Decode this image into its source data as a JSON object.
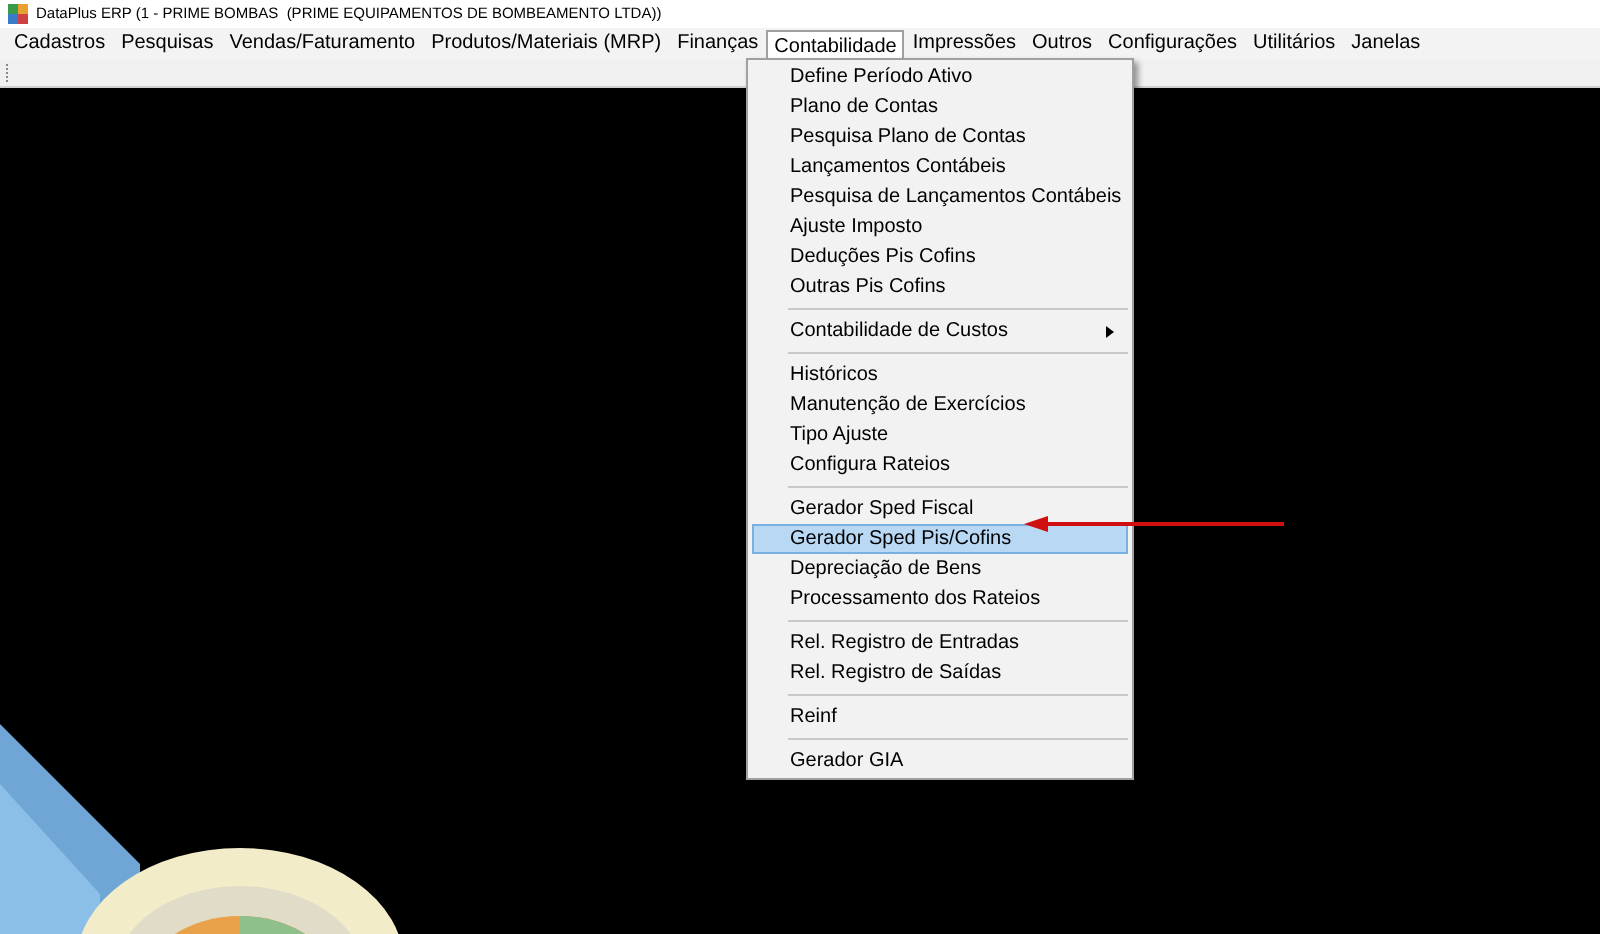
{
  "window": {
    "title": "DataPlus ERP (1 - PRIME BOMBAS  (PRIME EQUIPAMENTOS DE BOMBEAMENTO LTDA))"
  },
  "menubar": [
    {
      "label": "Cadastros",
      "selected": false
    },
    {
      "label": "Pesquisas",
      "selected": false
    },
    {
      "label": "Vendas/Faturamento",
      "selected": false
    },
    {
      "label": "Produtos/Materiais (MRP)",
      "selected": false
    },
    {
      "label": "Finanças",
      "selected": false
    },
    {
      "label": "Contabilidade",
      "selected": true
    },
    {
      "label": "Impressões",
      "selected": false
    },
    {
      "label": "Outros",
      "selected": false
    },
    {
      "label": "Configurações",
      "selected": false
    },
    {
      "label": "Utilitários",
      "selected": false
    },
    {
      "label": "Janelas",
      "selected": false
    }
  ],
  "dropdown": {
    "groups": [
      {
        "items": [
          {
            "label": "Define Período Ativo",
            "kind": "item",
            "selected": false
          },
          {
            "label": "Plano de Contas",
            "kind": "item",
            "selected": false
          },
          {
            "label": "Pesquisa Plano de Contas",
            "kind": "item",
            "selected": false
          },
          {
            "label": "Lançamentos Contábeis",
            "kind": "item",
            "selected": false
          },
          {
            "label": "Pesquisa de Lançamentos Contábeis",
            "kind": "item",
            "selected": false
          },
          {
            "label": "Ajuste Imposto",
            "kind": "item",
            "selected": false
          },
          {
            "label": "Deduções Pis Cofins",
            "kind": "item",
            "selected": false
          },
          {
            "label": "Outras Pis Cofins",
            "kind": "item",
            "selected": false
          }
        ]
      },
      {
        "items": [
          {
            "label": "Contabilidade de Custos",
            "kind": "submenu",
            "selected": false
          }
        ]
      },
      {
        "items": [
          {
            "label": "Históricos",
            "kind": "item",
            "selected": false
          },
          {
            "label": "Manutenção de Exercícios",
            "kind": "item",
            "selected": false
          },
          {
            "label": "Tipo Ajuste",
            "kind": "item",
            "selected": false
          },
          {
            "label": "Configura Rateios",
            "kind": "item",
            "selected": false
          }
        ]
      },
      {
        "items": [
          {
            "label": "Gerador Sped Fiscal",
            "kind": "item",
            "selected": false
          },
          {
            "label": "Gerador Sped Pis/Cofins",
            "kind": "item",
            "selected": true
          },
          {
            "label": "Depreciação de Bens",
            "kind": "item",
            "selected": false
          },
          {
            "label": "Processamento dos Rateios",
            "kind": "item",
            "selected": false
          }
        ]
      },
      {
        "items": [
          {
            "label": "Rel. Registro de Entradas",
            "kind": "item",
            "selected": false
          },
          {
            "label": "Rel. Registro de Saídas",
            "kind": "item",
            "selected": false
          }
        ]
      },
      {
        "items": [
          {
            "label": "Reinf",
            "kind": "item",
            "selected": false
          }
        ]
      },
      {
        "items": [
          {
            "label": "Gerador GIA",
            "kind": "item",
            "selected": false
          }
        ]
      }
    ]
  }
}
